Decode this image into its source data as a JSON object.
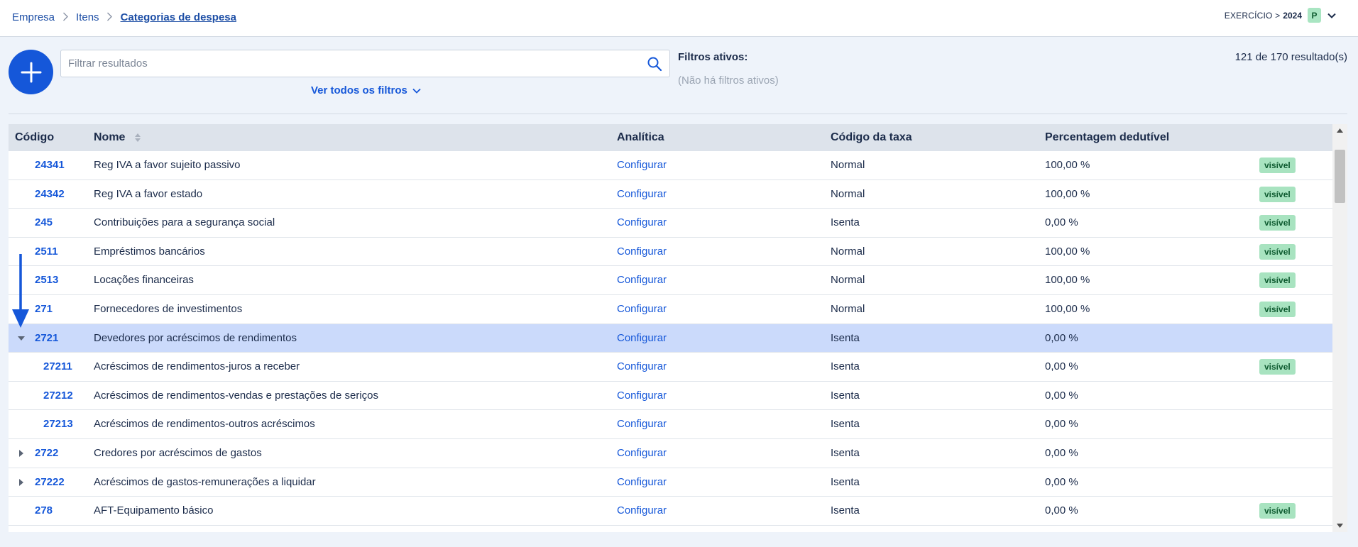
{
  "breadcrumb": {
    "items": [
      "Empresa",
      "Itens",
      "Categorias de despesa"
    ]
  },
  "exercise": {
    "label": "EXERCÍCIO >",
    "year": "2024",
    "badge": "P"
  },
  "toolbar": {
    "add_icon": "plus-icon",
    "search_placeholder": "Filtrar resultados",
    "search_value": "",
    "all_filters": "Ver todos os filtros",
    "filters_title": "Filtros ativos:",
    "filters_empty": "(Não há filtros ativos)",
    "results": "121 de 170 resultado(s)"
  },
  "table": {
    "headers": {
      "codigo": "Código",
      "nome": "Nome",
      "analitica": "Analítica",
      "taxa": "Código da taxa",
      "percent": "Percentagem dedutível"
    },
    "rows": [
      {
        "code": "24341",
        "name": "Reg IVA a favor sujeito passivo",
        "analytic": "Configurar",
        "tax": "Normal",
        "pct": "100,00 %",
        "badge": "visível",
        "toggle": "",
        "indent": 1
      },
      {
        "code": "24342",
        "name": "Reg IVA a favor estado",
        "analytic": "Configurar",
        "tax": "Normal",
        "pct": "100,00 %",
        "badge": "visível",
        "toggle": "",
        "indent": 1
      },
      {
        "code": "245",
        "name": "Contribuições para a segurança social",
        "analytic": "Configurar",
        "tax": "Isenta",
        "pct": "0,00 %",
        "badge": "visível",
        "toggle": "",
        "indent": 1
      },
      {
        "code": "2511",
        "name": "Empréstimos bancários",
        "analytic": "Configurar",
        "tax": "Normal",
        "pct": "100,00 %",
        "badge": "visível",
        "toggle": "",
        "indent": 1
      },
      {
        "code": "2513",
        "name": "Locações financeiras",
        "analytic": "Configurar",
        "tax": "Normal",
        "pct": "100,00 %",
        "badge": "visível",
        "toggle": "",
        "indent": 1
      },
      {
        "code": "271",
        "name": "Fornecedores de investimentos",
        "analytic": "Configurar",
        "tax": "Normal",
        "pct": "100,00 %",
        "badge": "visível",
        "toggle": "",
        "indent": 1
      },
      {
        "code": "2721",
        "name": "Devedores por acréscimos de rendimentos",
        "analytic": "Configurar",
        "tax": "Isenta",
        "pct": "0,00 %",
        "badge": "",
        "toggle": "expanded",
        "indent": 1,
        "selected": true
      },
      {
        "code": "27211",
        "name": "Acréscimos de rendimentos-juros a receber",
        "analytic": "Configurar",
        "tax": "Isenta",
        "pct": "0,00 %",
        "badge": "visível",
        "toggle": "",
        "indent": 2
      },
      {
        "code": "27212",
        "name": "Acréscimos de rendimentos-vendas e prestações de seriços",
        "analytic": "Configurar",
        "tax": "Isenta",
        "pct": "0,00 %",
        "badge": "",
        "toggle": "",
        "indent": 2
      },
      {
        "code": "27213",
        "name": "Acréscimos de rendimentos-outros acréscimos",
        "analytic": "Configurar",
        "tax": "Isenta",
        "pct": "0,00 %",
        "badge": "",
        "toggle": "",
        "indent": 2
      },
      {
        "code": "2722",
        "name": "Credores por acréscimos de gastos",
        "analytic": "Configurar",
        "tax": "Isenta",
        "pct": "0,00 %",
        "badge": "",
        "toggle": "collapsed",
        "indent": 1
      },
      {
        "code": "27222",
        "name": "Acréscimos de gastos-remunerações a liquidar",
        "analytic": "Configurar",
        "tax": "Isenta",
        "pct": "0,00 %",
        "badge": "",
        "toggle": "collapsed",
        "indent": 1
      },
      {
        "code": "278",
        "name": "AFT-Equipamento básico",
        "analytic": "Configurar",
        "tax": "Isenta",
        "pct": "0,00 %",
        "badge": "visível",
        "toggle": "",
        "indent": 1
      }
    ]
  },
  "icons": {
    "search": "search-icon",
    "chevron": "chevron-down-icon",
    "sort": "sort-icon",
    "annotation": "arrow-down-icon"
  },
  "colors": {
    "accent": "#1557d9",
    "selected_row": "#cbdafb",
    "badge_bg": "#a8e3c0",
    "header_bg": "#dde3eb"
  }
}
